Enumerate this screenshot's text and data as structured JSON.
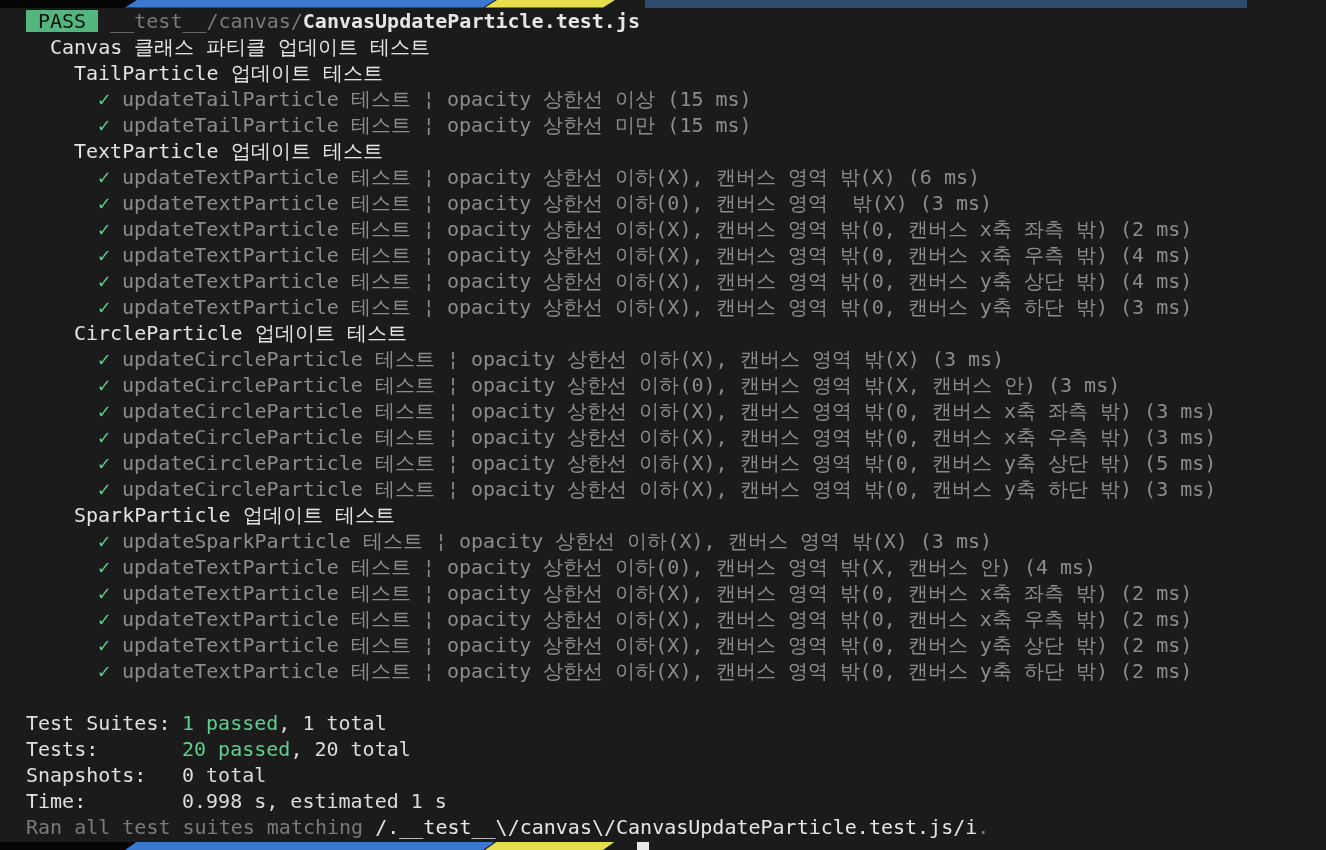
{
  "result": {
    "badge": "PASS",
    "path_dir": "__test__/canvas/",
    "path_file": "CanvasUpdateParticle.test.js"
  },
  "suite": "Canvas 클래스 파티클 업데이트 테스트",
  "groups": [
    {
      "name": "TailParticle 업데이트 테스트",
      "tests": [
        {
          "mark": "✓",
          "text": "updateTailParticle 테스트 ¦ opacity 상한선 이상 (15 ms)"
        },
        {
          "mark": "✓",
          "text": "updateTailParticle 테스트 ¦ opacity 상한선 미만 (15 ms)"
        }
      ]
    },
    {
      "name": "TextParticle 업데이트 테스트",
      "tests": [
        {
          "mark": "✓",
          "text": "updateTextParticle 테스트 ¦ opacity 상한선 이하(X), 캔버스 영역 밖(X) (6 ms)"
        },
        {
          "mark": "✓",
          "text": "updateTextParticle 테스트 ¦ opacity 상한선 이하(0), 캔버스 영역  밖(X) (3 ms)"
        },
        {
          "mark": "✓",
          "text": "updateTextParticle 테스트 ¦ opacity 상한선 이하(X), 캔버스 영역 밖(0, 캔버스 x축 좌측 밖) (2 ms)"
        },
        {
          "mark": "✓",
          "text": "updateTextParticle 테스트 ¦ opacity 상한선 이하(X), 캔버스 영역 밖(0, 캔버스 x축 우측 밖) (4 ms)"
        },
        {
          "mark": "✓",
          "text": "updateTextParticle 테스트 ¦ opacity 상한선 이하(X), 캔버스 영역 밖(0, 캔버스 y축 상단 밖) (4 ms)"
        },
        {
          "mark": "✓",
          "text": "updateTextParticle 테스트 ¦ opacity 상한선 이하(X), 캔버스 영역 밖(0, 캔버스 y축 하단 밖) (3 ms)"
        }
      ]
    },
    {
      "name": "CircleParticle 업데이트 테스트",
      "tests": [
        {
          "mark": "✓",
          "text": "updateCircleParticle 테스트 ¦ opacity 상한선 이하(X), 캔버스 영역 밖(X) (3 ms)"
        },
        {
          "mark": "✓",
          "text": "updateCircleParticle 테스트 ¦ opacity 상한선 이하(0), 캔버스 영역 밖(X, 캔버스 안) (3 ms)"
        },
        {
          "mark": "✓",
          "text": "updateCircleParticle 테스트 ¦ opacity 상한선 이하(X), 캔버스 영역 밖(0, 캔버스 x축 좌측 밖) (3 ms)"
        },
        {
          "mark": "✓",
          "text": "updateCircleParticle 테스트 ¦ opacity 상한선 이하(X), 캔버스 영역 밖(0, 캔버스 x축 우측 밖) (3 ms)"
        },
        {
          "mark": "✓",
          "text": "updateCircleParticle 테스트 ¦ opacity 상한선 이하(X), 캔버스 영역 밖(0, 캔버스 y축 상단 밖) (5 ms)"
        },
        {
          "mark": "✓",
          "text": "updateCircleParticle 테스트 ¦ opacity 상한선 이하(X), 캔버스 영역 밖(0, 캔버스 y축 하단 밖) (3 ms)"
        }
      ]
    },
    {
      "name": "SparkParticle 업데이트 테스트",
      "tests": [
        {
          "mark": "✓",
          "text": "updateSparkParticle 테스트 ¦ opacity 상한선 이하(X), 캔버스 영역 밖(X) (3 ms)"
        },
        {
          "mark": "✓",
          "text": "updateTextParticle 테스트 ¦ opacity 상한선 이하(0), 캔버스 영역 밖(X, 캔버스 안) (4 ms)"
        },
        {
          "mark": "✓",
          "text": "updateTextParticle 테스트 ¦ opacity 상한선 이하(X), 캔버스 영역 밖(0, 캔버스 x축 좌측 밖) (2 ms)"
        },
        {
          "mark": "✓",
          "text": "updateTextParticle 테스트 ¦ opacity 상한선 이하(X), 캔버스 영역 밖(0, 캔버스 x축 우측 밖) (2 ms)"
        },
        {
          "mark": "✓",
          "text": "updateTextParticle 테스트 ¦ opacity 상한선 이하(X), 캔버스 영역 밖(0, 캔버스 y축 상단 밖) (2 ms)"
        },
        {
          "mark": "✓",
          "text": "updateTextParticle 테스트 ¦ opacity 상한선 이하(X), 캔버스 영역 밖(0, 캔버스 y축 하단 밖) (2 ms)"
        }
      ]
    }
  ],
  "summary": [
    {
      "label": "Test Suites:",
      "parts": [
        {
          "kind": "passed",
          "text": "1 passed"
        },
        {
          "kind": "plain",
          "text": ", 1 total"
        }
      ]
    },
    {
      "label": "Tests:",
      "parts": [
        {
          "kind": "passed",
          "text": "20 passed"
        },
        {
          "kind": "plain",
          "text": ", 20 total"
        }
      ]
    },
    {
      "label": "Snapshots:",
      "parts": [
        {
          "kind": "plain",
          "text": "0 total"
        }
      ]
    },
    {
      "label": "Time:",
      "parts": [
        {
          "kind": "plain",
          "text": "0.998 s, estimated 1 s"
        }
      ]
    }
  ],
  "ran": {
    "prefix": "Ran all test suites matching ",
    "pattern": "/.__test__\\/canvas\\/CanvasUpdateParticle.test.js/i",
    "suffix": "."
  }
}
